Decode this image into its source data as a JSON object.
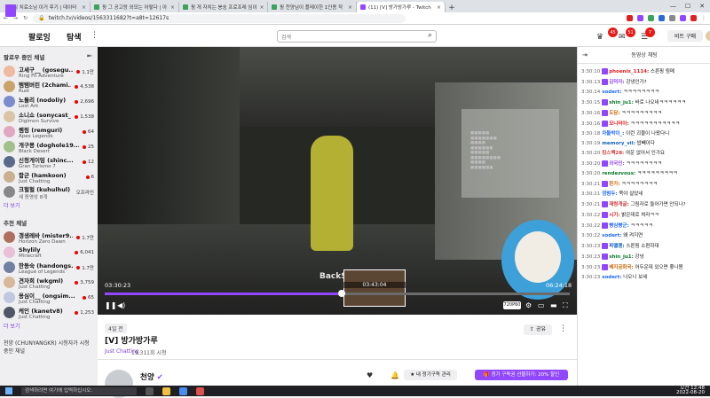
{
  "browser": {
    "tabs": [
      {
        "title": "핑 치료소님 이거 후기 | 데이터",
        "active": false,
        "twitch": false
      },
      {
        "title": "핑 그 공고랑 외모는 어떻다 | 아",
        "active": false,
        "twitch": false
      },
      {
        "title": "핑 게 자치는 봉숭 프로프레 임이",
        "active": false,
        "twitch": false
      },
      {
        "title": "핑 천양님이 플레이한 1인용 작",
        "active": false,
        "twitch": false
      },
      {
        "title": "(11) [V] 방가방가루 - Twitch",
        "active": true,
        "twitch": true
      }
    ],
    "new_tab": "+",
    "url": "twitch.tv/videos/1563311682?t=a8t=12617s",
    "window_controls": [
      "—",
      "☐",
      "✕"
    ]
  },
  "nav": {
    "following": "팔로잉",
    "browse": "탐색",
    "search_placeholder": "검색",
    "badge_counts": [
      "45",
      "51",
      "7"
    ],
    "bits_label": "비트 구매"
  },
  "sidebar": {
    "followed_header": "팔로우 중인 채널",
    "followed": [
      {
        "name": "고세구__ (gosegu...",
        "game": "Ring Fit Adventure",
        "viewers": "1.1만",
        "live": true
      },
      {
        "name": "탬탬버린 (2chami...",
        "game": "Rust",
        "viewers": "4,538",
        "live": true
      },
      {
        "name": "노돌리 (nodoliy)",
        "game": "Lost Ark",
        "viewers": "2,696",
        "live": true
      },
      {
        "name": "소니쇼 (sonycast_)",
        "game": "Digimon Survive",
        "viewers": "1,538",
        "live": true
      },
      {
        "name": "렘링 (remguri)",
        "game": "Apex Legends",
        "viewers": "64",
        "live": true
      },
      {
        "name": "개구몽 (doghole19...",
        "game": "Black Desert",
        "viewers": "25",
        "live": true
      },
      {
        "name": "신청게이밍 (shinc...",
        "game": "Gran Turismo 7",
        "viewers": "12",
        "live": true
      },
      {
        "name": "함군 (hamkoon)",
        "game": "Just Chatting",
        "viewers": "6",
        "live": true
      },
      {
        "name": "크헐헐 (kuhulhul)",
        "game": "새 동영상 8개",
        "viewers": "오프라인",
        "live": false
      }
    ],
    "followed_more": "더 보기",
    "recommended_header": "추천 채널",
    "recommended": [
      {
        "name": "갱생레바 (mister9...",
        "game": "Horizon Zero Dawn",
        "viewers": "1.7만"
      },
      {
        "name": "Shylily",
        "game": "Minecraft",
        "viewers": "6,041"
      },
      {
        "name": "한동숙 (handongs...",
        "game": "League of Legends",
        "viewers": "1.7만"
      },
      {
        "name": "견자희 (wkgml)",
        "game": "Just Chatting",
        "viewers": "3,759"
      },
      {
        "name": "용심이__ (ongsim...",
        "game": "Just Chatting",
        "viewers": "65"
      },
      {
        "name": "케인 (kanetv8)",
        "game": "Just Chatting",
        "viewers": "1,253"
      }
    ],
    "recommended_more": "더 보기",
    "hosting_note": "천양 (CHUNYANGKR) 시청자가 시청 중인 채널"
  },
  "video": {
    "current_time": "03:30:23",
    "end_time": "06:24:18",
    "preview_time": "03:43:04",
    "watermark": "BackS",
    "quality": "720P60",
    "progress": 0.51
  },
  "info": {
    "ago": "4일 전",
    "title": "[V] 방가방가루",
    "category": "Just Chatting",
    "views": "19,311회 시청",
    "share": "공유",
    "channel": "천양",
    "gift_sub": "내 정기구독 관리",
    "sub_offer": "정기 구독권 선물하기: 20% 할인"
  },
  "chat": {
    "header": "동영상 채팅",
    "messages": [
      {
        "t": "3:30:10",
        "user": "phoenix_1114:",
        "color": "#e02020",
        "text": "스른핑 됨메",
        "emote": true
      },
      {
        "t": "3:30:13",
        "user": "김덕자:",
        "color": "#9147ff",
        "text": "강냉인가?",
        "emote": true
      },
      {
        "t": "3:30:14",
        "user": "sodert:",
        "color": "#1e69ff",
        "text": "ㅋㅋㅋㅋㅋㅋㅋㅋ",
        "emote": false
      },
      {
        "t": "3:30:15",
        "user": "shin_ju1:",
        "color": "#0a7a2a",
        "text": "바로 나오네ㅋㅋㅋㅋㅋㅋ",
        "emote": true
      },
      {
        "t": "3:30:16",
        "user": "도담:",
        "color": "#c86400",
        "text": "ㅋㅋㅋㅋㅋㅋㅋㅋㅋ",
        "emote": true
      },
      {
        "t": "3:30:16",
        "user": "모니터아:",
        "color": "#e02020",
        "text": "ㅋㅋㅋㅋㅋㅋㅋㅋㅋㅋㅋ",
        "emote": true
      },
      {
        "t": "3:30:18",
        "user": "차돌박이_:",
        "color": "#1e69ff",
        "text": "이런 괴물이 나왔다니",
        "emote": false
      },
      {
        "t": "3:30:19",
        "user": "memory_vil:",
        "color": "#0a5fbf",
        "text": "쌉빼이다",
        "emote": false
      },
      {
        "t": "3:30:20",
        "user": "킹스팩28:",
        "color": "#d03a3a",
        "text": "여운 없어서 인가요",
        "emote": false
      },
      {
        "t": "3:30:20",
        "user": "외국인:",
        "color": "#9147ff",
        "text": "ㅋㅋㅋㅋㅋㅋㅋㅋ",
        "emote": true
      },
      {
        "t": "3:30:20",
        "user": "rendezvous:",
        "color": "#0a7a2a",
        "text": "ㅋㅋㅋㅋㅋㅋㅋㅋㅋ",
        "emote": false
      },
      {
        "t": "3:30:21",
        "user": "한가:",
        "color": "#c86400",
        "text": "ㅋㅋㅋㅋㅋㅋㅋㅋ",
        "emote": true
      },
      {
        "t": "3:30:21",
        "user": "정범두:",
        "color": "#1e69ff",
        "text": "쪽야 살았네",
        "emote": false
      },
      {
        "t": "3:30:21",
        "user": "재령개굴:",
        "color": "#d03a3a",
        "text": "그림자로 들어가면 안되나?",
        "emote": true
      },
      {
        "t": "3:30:22",
        "user": "시기:",
        "color": "#e02020",
        "text": "밝은데로 쳐라ㅋㅋ",
        "emote": true
      },
      {
        "t": "3:30:22",
        "user": "빵심빵군:",
        "color": "#1e69ff",
        "text": "ㅋㅋㅋㅋㅋ",
        "emote": true
      },
      {
        "t": "3:30:22",
        "user": "sodert:",
        "color": "#1e69ff",
        "text": "왜 켜지연",
        "emote": false
      },
      {
        "t": "3:30:23",
        "user": "파멜렌:",
        "color": "#0a5fbf",
        "text": "스른핑 소편하대",
        "emote": true
      },
      {
        "t": "3:30:23",
        "user": "shin_ju1:",
        "color": "#0a7a2a",
        "text": "강넝",
        "emote": true
      },
      {
        "t": "3:30:23",
        "user": "베지공화국:",
        "color": "#c86400",
        "text": "어두운데 있으면 좋나봄",
        "emote": true
      },
      {
        "t": "3:30:23",
        "user": "sodert:",
        "color": "#1e69ff",
        "text": "나오니 보세",
        "emote": false
      }
    ]
  },
  "taskbar": {
    "search_placeholder": "검색하려면 여기에 입력하십시오.",
    "time": "오전 12:48",
    "date": "2022-08-20"
  }
}
